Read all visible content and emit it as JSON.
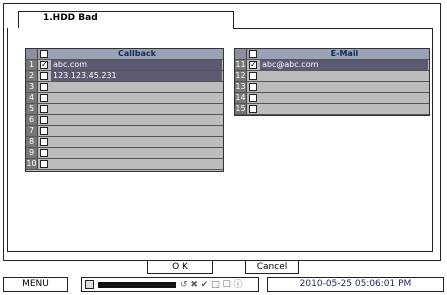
{
  "tab": {
    "title": "1.HDD Bad"
  },
  "callback": {
    "header": "Callback",
    "rows": [
      {
        "num": "1",
        "checked": true,
        "value": "abc.com"
      },
      {
        "num": "2",
        "checked": false,
        "value": "123.123.45.231"
      },
      {
        "num": "3",
        "checked": false,
        "value": ""
      },
      {
        "num": "4",
        "checked": false,
        "value": ""
      },
      {
        "num": "5",
        "checked": false,
        "value": ""
      },
      {
        "num": "6",
        "checked": false,
        "value": ""
      },
      {
        "num": "7",
        "checked": false,
        "value": ""
      },
      {
        "num": "8",
        "checked": false,
        "value": ""
      },
      {
        "num": "9",
        "checked": false,
        "value": ""
      },
      {
        "num": "10",
        "checked": false,
        "value": ""
      }
    ]
  },
  "email": {
    "header": "E-Mail",
    "rows": [
      {
        "num": "11",
        "checked": true,
        "value": "abc@abc.com"
      },
      {
        "num": "12",
        "checked": false,
        "value": ""
      },
      {
        "num": "13",
        "checked": false,
        "value": ""
      },
      {
        "num": "14",
        "checked": false,
        "value": ""
      },
      {
        "num": "15",
        "checked": false,
        "value": ""
      }
    ]
  },
  "buttons": {
    "ok": "O K",
    "cancel": "Cancel"
  },
  "statusbar": {
    "menu": "MENU",
    "icons": "↺ ✖ ✔ □ ☐ ⓘ",
    "datetime": "2010-05-25 05:06:01 PM"
  }
}
